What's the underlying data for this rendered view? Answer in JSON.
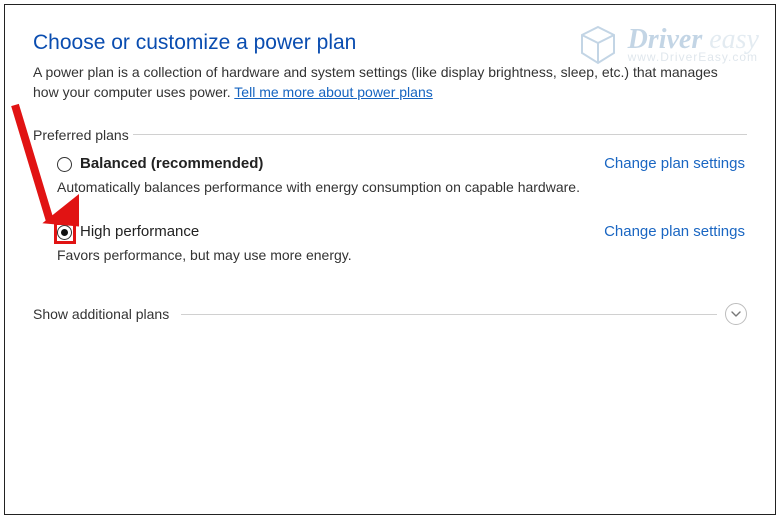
{
  "title": "Choose or customize a power plan",
  "intro_text": "A power plan is a collection of hardware and system settings (like display brightness, sleep, etc.) that manages how your computer uses power. ",
  "intro_link": "Tell me more about power plans",
  "preferred_legend": "Preferred plans",
  "plans": [
    {
      "name": "Balanced (recommended)",
      "desc": "Automatically balances performance with energy consumption on capable hardware.",
      "link": "Change plan settings",
      "selected": false,
      "highlighted": false,
      "bold": true
    },
    {
      "name": "High performance",
      "desc": "Favors performance, but may use more energy.",
      "link": "Change plan settings",
      "selected": true,
      "highlighted": true,
      "bold": false
    }
  ],
  "additional_label": "Show additional plans",
  "watermark": {
    "brand_primary": "Driver",
    "brand_secondary": " easy",
    "url": "www.DriverEasy.com"
  },
  "colors": {
    "accent": "#1564c0",
    "heading": "#0a4db0",
    "highlight": "#e11313"
  }
}
